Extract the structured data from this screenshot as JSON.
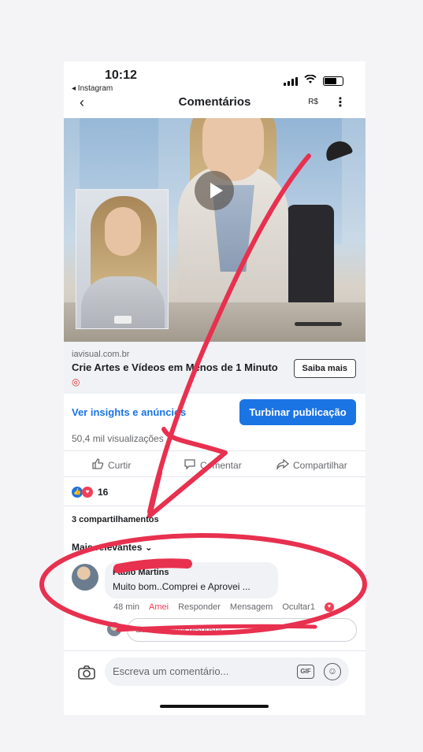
{
  "status_bar": {
    "time": "10:12",
    "back_app": "◂ Instagram"
  },
  "nav": {
    "title": "Comentários",
    "currency": "R$"
  },
  "ad": {
    "domain": "iavisual.com.br",
    "headline": "Crie Artes e Vídeos em Menos de 1 Minuto",
    "cta_label": "Saiba mais"
  },
  "actions": {
    "insights_label": "Ver insights e anúncios",
    "boost_label": "Turbinar publicação",
    "views": "50,4 mil visualizações",
    "like_label": "Curtir",
    "comment_label": "Comentar",
    "share_label": "Compartilhar"
  },
  "reactions": {
    "count": "16"
  },
  "shares": "3 compartilhamentos",
  "sort": {
    "label": "Mais relevantes"
  },
  "comment": {
    "author": "Fabio Martins",
    "text": "Muito bom..Comprei e Aprovei ...",
    "time": "48 min",
    "reaction_label": "Amei",
    "reply_label": "Responder",
    "message_label": "Mensagem",
    "hide_label": "Ocultar",
    "reaction_count": "1"
  },
  "reply": {
    "placeholder": "Escreva uma resposta..."
  },
  "composer": {
    "placeholder": "Escreva um comentário...",
    "gif_label": "GIF"
  },
  "colors": {
    "accent": "#1b74e4",
    "love": "#f33e58",
    "annotation": "#e8304f"
  }
}
